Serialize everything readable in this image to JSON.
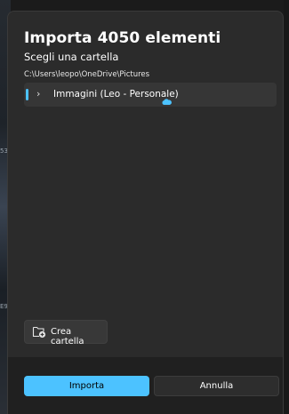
{
  "background": {
    "ticks": [
      "53",
      "E9"
    ]
  },
  "dialog": {
    "title": "Importa 4050 elementi",
    "subtitle": "Scegli una cartella",
    "path": "C:\\Users\\leopo\\OneDrive\\Pictures",
    "tree": {
      "items": [
        {
          "label": "Immagini (Leo - Personale)",
          "icon": "onedrive-cloud-icon",
          "selected": true
        }
      ]
    },
    "new_folder": {
      "label": "Crea cartella",
      "icon": "new-folder-icon"
    },
    "footer": {
      "primary_label": "Importa",
      "secondary_label": "Annulla"
    },
    "colors": {
      "accent": "#4cc2ff",
      "dialog_bg": "#2b2b2b",
      "footer_bg": "#202020"
    }
  }
}
